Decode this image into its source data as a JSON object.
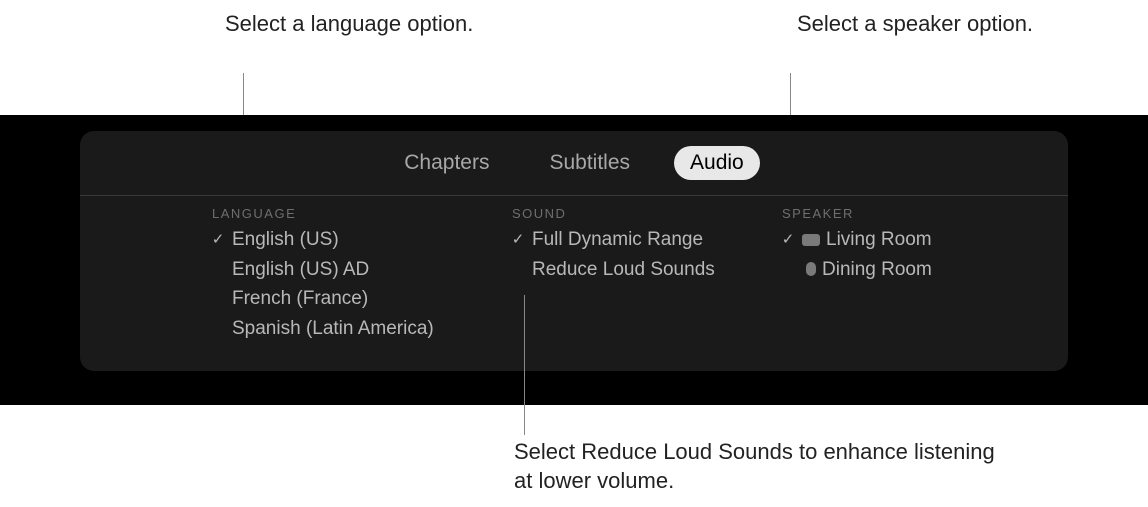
{
  "callouts": {
    "language": "Select a language option.",
    "speaker": "Select a speaker option.",
    "sound": "Select Reduce Loud Sounds to enhance listening at lower volume."
  },
  "tabs": {
    "chapters": "Chapters",
    "subtitles": "Subtitles",
    "audio": "Audio"
  },
  "language": {
    "header": "LANGUAGE",
    "items": [
      {
        "label": "English (US)",
        "selected": true
      },
      {
        "label": "English (US) AD",
        "selected": false
      },
      {
        "label": "French (France)",
        "selected": false
      },
      {
        "label": "Spanish (Latin America)",
        "selected": false
      }
    ]
  },
  "sound": {
    "header": "SOUND",
    "items": [
      {
        "label": "Full Dynamic Range",
        "selected": true
      },
      {
        "label": "Reduce Loud Sounds",
        "selected": false
      }
    ]
  },
  "speaker": {
    "header": "SPEAKER",
    "items": [
      {
        "label": "Living Room",
        "selected": true,
        "icon": "tv"
      },
      {
        "label": "Dining Room",
        "selected": false,
        "icon": "pod"
      }
    ]
  }
}
